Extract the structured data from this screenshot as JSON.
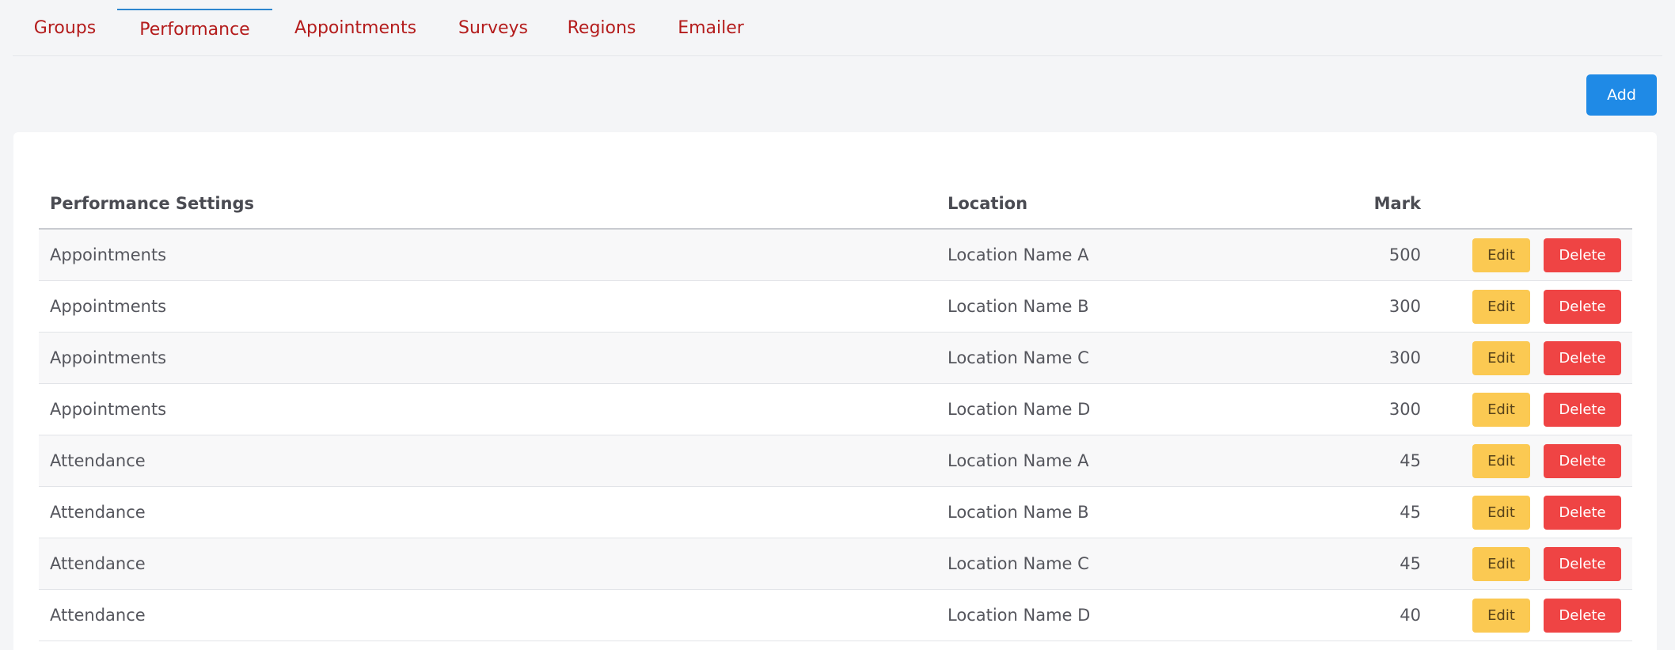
{
  "tabs": [
    {
      "label": "Groups",
      "active": false
    },
    {
      "label": "Performance",
      "active": true
    },
    {
      "label": "Appointments",
      "active": false
    },
    {
      "label": "Surveys",
      "active": false
    },
    {
      "label": "Regions",
      "active": false
    },
    {
      "label": "Emailer",
      "active": false
    }
  ],
  "add_button_label": "Add",
  "table": {
    "headers": {
      "setting": "Performance Settings",
      "location": "Location",
      "mark": "Mark"
    },
    "edit_label": "Edit",
    "delete_label": "Delete",
    "rows": [
      {
        "setting": "Appointments",
        "location": "Location Name A",
        "mark": "500"
      },
      {
        "setting": "Appointments",
        "location": "Location Name B",
        "mark": "300"
      },
      {
        "setting": "Appointments",
        "location": "Location Name C",
        "mark": "300"
      },
      {
        "setting": "Appointments",
        "location": "Location Name D",
        "mark": "300"
      },
      {
        "setting": "Attendance",
        "location": "Location Name A",
        "mark": "45"
      },
      {
        "setting": "Attendance",
        "location": "Location Name B",
        "mark": "45"
      },
      {
        "setting": "Attendance",
        "location": "Location Name C",
        "mark": "45"
      },
      {
        "setting": "Attendance",
        "location": "Location Name D",
        "mark": "40"
      }
    ]
  },
  "colors": {
    "tab_text": "#b41c1c",
    "active_tab_indicator": "#2d86cf",
    "add_button": "#1f8ae6",
    "edit_button": "#fbc952",
    "delete_button": "#ef4444"
  }
}
